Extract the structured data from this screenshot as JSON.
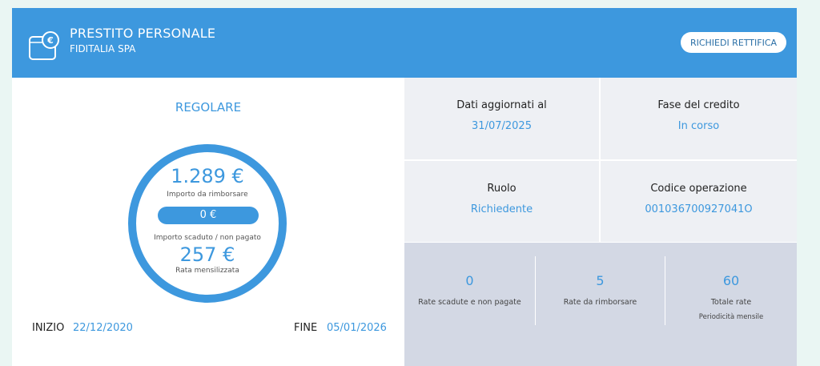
{
  "header": {
    "title": "PRESTITO PERSONALE",
    "subtitle": "FIDITALIA SPA",
    "action_label": "RICHIEDI RETTIFICA",
    "icon": "wallet-euro-icon"
  },
  "summary": {
    "status": "REGOLARE",
    "amount_due": "1.289 €",
    "amount_due_label": "Importo da rimborsare",
    "overdue_amount": "0 €",
    "overdue_label": "Importo scaduto / non pagato",
    "monthly_installment": "257 €",
    "monthly_label": "Rata mensilizzata",
    "start_label": "INIZIO",
    "start_date": "22/12/2020",
    "end_label": "FINE",
    "end_date": "05/01/2026"
  },
  "info": [
    {
      "title": "Dati aggiornati al",
      "value": "31/07/2025"
    },
    {
      "title": "Fase del credito",
      "value": "In corso"
    },
    {
      "title": "Ruolo",
      "value": "Richiedente"
    },
    {
      "title": "Codice operazione",
      "value": "001036700927041O"
    }
  ],
  "stats": [
    {
      "value": "0",
      "label": "Rate scadute e non pagate"
    },
    {
      "value": "5",
      "label": "Rate da rimborsare"
    },
    {
      "value": "60",
      "label": "Totale rate",
      "sublabel": "Periodicità mensile"
    }
  ],
  "colors": {
    "accent": "#3d98de",
    "page_bg": "#eaf6f3",
    "info_bg": "#eef0f4",
    "stats_bg": "#d3d8e4"
  }
}
